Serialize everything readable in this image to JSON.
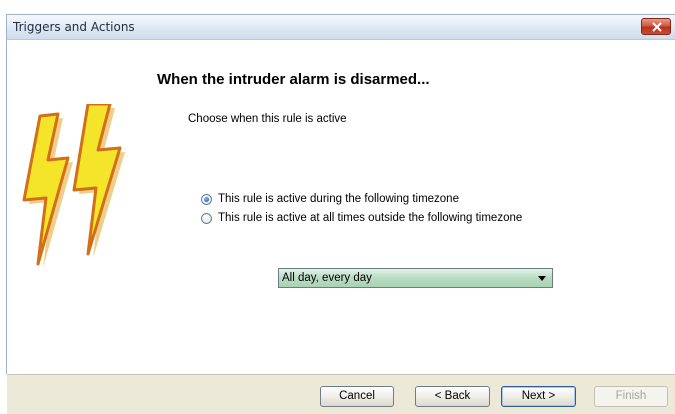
{
  "window": {
    "title": "Triggers and Actions"
  },
  "main": {
    "heading": "When the intruder alarm is disarmed...",
    "subheading": "Choose when this rule is active",
    "options": [
      {
        "label": "This rule is active during the following timezone",
        "checked": true
      },
      {
        "label": "This rule is active at all times outside the following timezone",
        "checked": false
      }
    ],
    "timezone_select": {
      "value": "All day, every day"
    }
  },
  "footer": {
    "cancel": "Cancel",
    "back": "< Back",
    "next": "Next >",
    "finish": "Finish"
  },
  "icons": {
    "close": "close-icon",
    "illustration": "lightning-bolt-icon"
  },
  "colors": {
    "close_button": "#c94c35",
    "select_fill": "#b9dcc3",
    "bolt_fill": "#f4e52a",
    "bolt_outline": "#d36f17"
  }
}
